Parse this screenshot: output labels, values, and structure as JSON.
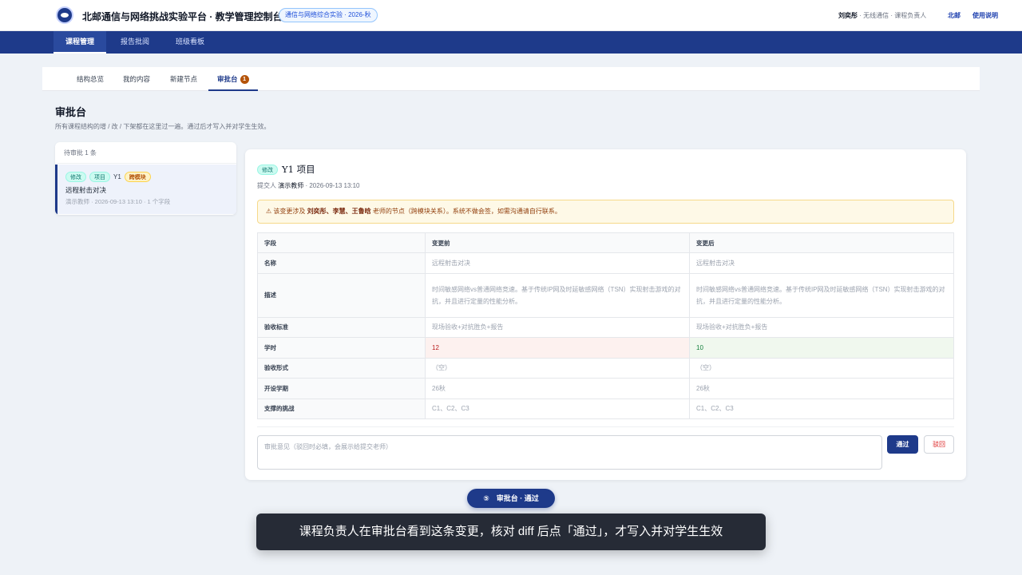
{
  "header": {
    "app_title": "北邮通信与网络挑战实验平台 · 教学管理控制台",
    "term_badge": "通信与网络综合实验 · 2026-秋",
    "user_name": "刘奕彤",
    "user_role": " · 无线通信 · 课程负责人",
    "org_link": "北邮",
    "help_link": "使用说明"
  },
  "nav": {
    "tabs": [
      {
        "label": "课程管理",
        "active": true
      },
      {
        "label": "报告批阅",
        "active": false
      },
      {
        "label": "班级看板",
        "active": false
      }
    ]
  },
  "subtabs": {
    "items": [
      {
        "label": "结构总览"
      },
      {
        "label": "我的内容"
      },
      {
        "label": "新建节点"
      },
      {
        "label": "审批台",
        "count": "1",
        "active": true
      }
    ]
  },
  "page": {
    "title": "审批台",
    "subtitle": "所有课程结构的增 / 改 / 下架都在这里过一遍。通过后才写入并对学生生效。"
  },
  "queue": {
    "header": "待审批 1 条",
    "items": [
      {
        "chips": [
          "修改",
          "项目"
        ],
        "code": "Y1",
        "tag": "跨模块",
        "title": "远程射击对决",
        "meta": "演示教师 · 2026-09-13 13:10 · 1 个字段"
      }
    ]
  },
  "detail": {
    "action_chip": "修改",
    "title": "Y1 项目",
    "submitter_label": "提交人 ",
    "submitter": "演示教师",
    "submit_time": " · 2026-09-13 13:10",
    "warning": {
      "prefix": "⚠ 该变更涉及 ",
      "names": "刘奕彤、李慧、王鲁晗",
      "suffix": " 老师的节点（跨模块关系）。系统不做会签，如需沟通请自行联系。"
    },
    "diff": {
      "headers": [
        "字段",
        "变更前",
        "变更后"
      ],
      "rows": [
        {
          "field": "名称",
          "before": "远程射击对决",
          "after": "远程射击对决"
        },
        {
          "field": "描述",
          "before": "时间敏感网络vs普通网络竞速。基于传统IP网及时延敏感网络（TSN）实现射击游戏的对抗，并且进行定量的性能分析。",
          "after": "时间敏感网络vs普通网络竞速。基于传统IP网及时延敏感网络（TSN）实现射击游戏的对抗，并且进行定量的性能分析。"
        },
        {
          "field": "验收标准",
          "before": "现场验收+对抗胜负+报告",
          "after": "现场验收+对抗胜负+报告"
        },
        {
          "field": "学时",
          "before": "12",
          "after": "10",
          "changed": true
        },
        {
          "field": "验收形式",
          "before": "（空）",
          "after": "（空）"
        },
        {
          "field": "开设学期",
          "before": "26秋",
          "after": "26秋"
        },
        {
          "field": "支撑的挑战",
          "before": "C1、C2、C3",
          "after": "C1、C2、C3"
        }
      ]
    },
    "comment_placeholder": "审批意见（驳回时必填，会展示给提交老师）",
    "pass_label": "通过",
    "reject_label": "驳回"
  },
  "overlay": {
    "step": "⑤　审批台 · 通过",
    "caption": "课程负责人在审批台看到这条变更，核对 diff 后点「通过」，才写入并对学生生效"
  },
  "colors": {
    "brand": "#1e3a8a",
    "warning_bg": "#fef9e7",
    "changed_before": "#b91c1c",
    "changed_after": "#15803d"
  },
  "icons": [
    "logo-icon",
    "warning-icon"
  ]
}
